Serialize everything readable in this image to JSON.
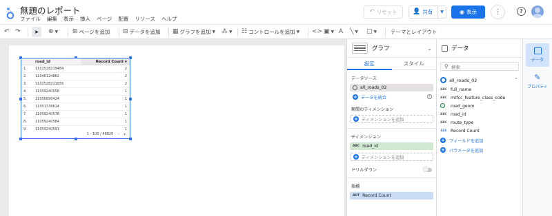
{
  "app": {
    "doc_title": "無題のレポート",
    "menus": [
      "ファイル",
      "編集",
      "表示",
      "挿入",
      "ページ",
      "配置",
      "リソース",
      "ヘルプ"
    ],
    "reset_label": "リセット",
    "share_label": "共有",
    "view_label": "表示"
  },
  "toolbar": {
    "add_page": "ページを追加",
    "add_data": "データを追加",
    "add_chart": "グラフを追加",
    "add_control": "コントロールを追加",
    "theme_layout": "テーマとレイアウト"
  },
  "table": {
    "col_id": "road_id",
    "col_rc": "Record Count",
    "rows": [
      {
        "idx": "1.",
        "id": "1102528219484",
        "rc": "2"
      },
      {
        "idx": "2.",
        "id": "11046124862",
        "rc": "2"
      },
      {
        "idx": "3.",
        "id": "1102528211955",
        "rc": "2"
      },
      {
        "idx": "4.",
        "id": "11059240558",
        "rc": "1"
      },
      {
        "idx": "5.",
        "id": "11050890424",
        "rc": "1"
      },
      {
        "idx": "6.",
        "id": "11051338614",
        "rc": "1"
      },
      {
        "idx": "7.",
        "id": "11059240578",
        "rc": "1"
      },
      {
        "idx": "8.",
        "id": "11059240584",
        "rc": "1"
      },
      {
        "idx": "9.",
        "id": "11059240591",
        "rc": "1"
      }
    ],
    "pagination": "1 - 100 / 48820"
  },
  "graph_panel": {
    "title": "グラフ",
    "tab_setup": "設定",
    "tab_style": "スタイル",
    "data_source_label": "データソース",
    "data_source": "all_roads_02",
    "blend_label": "データを統合",
    "date_dim_label": "期間のディメンション",
    "add_dimension": "ディメンションを追加",
    "dimension_label": "ディメンション",
    "dimension_value": "road_id",
    "dimension_badge": "ABC",
    "drilldown_label": "ドリルダウン",
    "metric_label": "指標",
    "metric_value": "Record Count",
    "metric_badge": "AUT"
  },
  "data_panel": {
    "title": "データ",
    "search_placeholder": "検索",
    "source": "all_roads_02",
    "fields": [
      {
        "type": "ABC",
        "name": "full_name"
      },
      {
        "type": "ABC",
        "name": "mtfcc_feature_class_code"
      },
      {
        "type": "geo",
        "name": "road_geom"
      },
      {
        "type": "ABC",
        "name": "road_id"
      },
      {
        "type": "ABC",
        "name": "route_type"
      },
      {
        "type": "123",
        "name": "Record Count"
      }
    ],
    "add_field": "フィールドを追加",
    "add_param": "パラメータを追加"
  },
  "rail": {
    "data_label": "データ",
    "props_label": "プロパティ"
  },
  "colors": {
    "accent": "#1a73e8",
    "dimension_chip": "#cfe8cf",
    "metric_chip": "#c9dcf5"
  }
}
